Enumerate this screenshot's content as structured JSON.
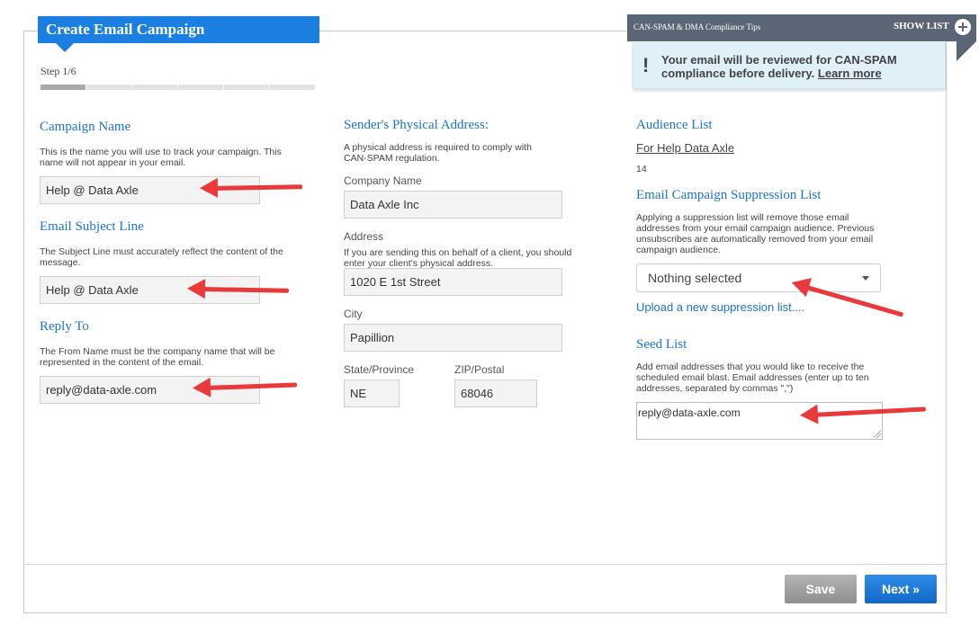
{
  "header": {
    "title": "Create Email Campaign",
    "step": "Step 1/6",
    "progress_steps_total": 6,
    "progress_steps_done": 1
  },
  "left": {
    "campaign_name": {
      "heading": "Campaign Name",
      "help": "This is the name you will use to track your campaign. This name will not appear in your email.",
      "value": "Help @ Data Axle"
    },
    "subject": {
      "heading": "Email Subject Line",
      "help": "The Subject Line must accurately reflect the content of the message.",
      "value": "Help @ Data Axle"
    },
    "reply_to": {
      "heading": "Reply To",
      "help": "The From Name must be the company name that will be represented in the content of the email.",
      "value": "reply@data-axle.com"
    }
  },
  "middle": {
    "heading": "Sender's Physical Address:",
    "help": "A physical address is required to comply with CAN-SPAM regulation.",
    "company_label": "Company Name",
    "company_value": "Data Axle Inc",
    "address_label": "Address",
    "address_help": "If you are sending this on behalf of a client, you should enter your client's physical address.",
    "address_value": "1020 E 1st Street",
    "city_label": "City",
    "city_value": "Papillion",
    "state_label": "State/Province",
    "state_value": "NE",
    "zip_label": "ZIP/Postal",
    "zip_value": "68046"
  },
  "right": {
    "audience_heading": "Audience List",
    "audience_link": "For Help Data Axle",
    "audience_count": "14",
    "suppression_heading": "Email Campaign Suppression List",
    "suppression_help": "Applying a suppression list will remove those email addresses from your email campaign audience. Previous unsubscribes are automatically removed from your email campaign audience.",
    "suppression_selected": "Nothing selected",
    "upload_link": "Upload a new suppression list....",
    "seed_heading": "Seed List",
    "seed_help": "Add email addresses that you would like to receive the scheduled email blast. Email addresses (enter up to ten addresses, separated by commas \",\")",
    "seed_value": "reply@data-axle.com"
  },
  "compliance": {
    "title": "CAN-SPAM & DMA Compliance Tips",
    "show_list": "SHOW LIST",
    "message": "Your email will be reviewed for CAN-SPAM compliance before delivery.",
    "learn_more": "Learn more"
  },
  "footer": {
    "save": "Save",
    "next": "Next »"
  },
  "colors": {
    "accent": "#1a7fe0",
    "annotation_arrow": "#e83a3a",
    "compliance_bar": "#5a6675",
    "compliance_box": "#dff0f9"
  }
}
